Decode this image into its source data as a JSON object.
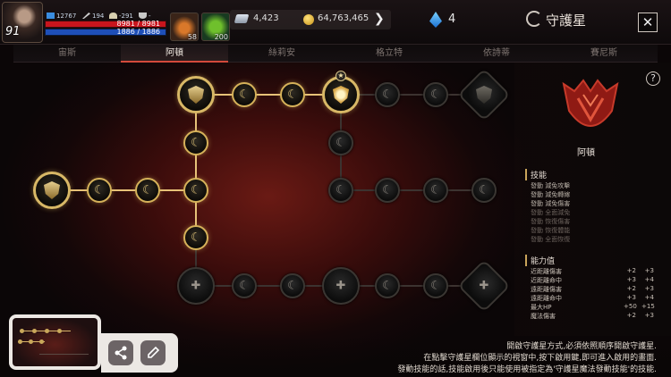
{
  "player": {
    "level": "91",
    "stat1": "12767",
    "stat2": "194",
    "stat3": "-291",
    "stat4": "-",
    "hp": "8981 / 8981",
    "mp": "1886 / 1886"
  },
  "slots": [
    {
      "icon": "flask-icon",
      "count": "58"
    },
    {
      "icon": "leaf-icon",
      "count": "200"
    }
  ],
  "currency": {
    "silver": "4,423",
    "gold": "64,763,465",
    "gems": "4"
  },
  "header": {
    "title": "守護星",
    "close": "✕"
  },
  "tabs": [
    {
      "label": "宙斯",
      "active": false
    },
    {
      "label": "阿頓",
      "active": true
    },
    {
      "label": "絲莉安",
      "active": false
    },
    {
      "label": "格立特",
      "active": false
    },
    {
      "label": "依詩蒂",
      "active": false
    },
    {
      "label": "賽尼斯",
      "active": false
    }
  ],
  "panel": {
    "help": "?",
    "name": "阿頓",
    "skills_title": "技能",
    "skills": [
      {
        "text": "發動 減免攻擊",
        "enabled": true
      },
      {
        "text": "發動 減免轉嫁",
        "enabled": true
      },
      {
        "text": "發動 減免傷害",
        "enabled": true
      },
      {
        "text": "發動 全面減免",
        "enabled": false
      },
      {
        "text": "發動 恢復傷害",
        "enabled": false
      },
      {
        "text": "發動 恢復體能",
        "enabled": false
      },
      {
        "text": "發動 全面恢復",
        "enabled": false
      }
    ],
    "ability_title": "能力值",
    "abilities": [
      {
        "label": "近距離傷害",
        "v1": "+2",
        "v2": "+3"
      },
      {
        "label": "近距離命中",
        "v1": "+3",
        "v2": "+4"
      },
      {
        "label": "遠距離傷害",
        "v1": "+2",
        "v2": "+3"
      },
      {
        "label": "遠距離命中",
        "v1": "+3",
        "v2": "+4"
      },
      {
        "label": "最大HP",
        "v1": "+50",
        "v2": "+15"
      },
      {
        "label": "魔法傷害",
        "v1": "+2",
        "v2": "+3"
      }
    ]
  },
  "description": [
    "開啟守護星方式,必須依照順序開啟守護星.",
    "在點擊守護星欄位顯示的視窗中,按下啟用鍵,即可進入啟用的畫面.",
    "發動技能的話,技能啟用後只能使用被指定為'守護星魔法發動技能'的技能."
  ],
  "toolbar": {
    "share_icon": "share-icon",
    "edit_icon": "pencil-icon"
  },
  "colors": {
    "accent": "#d34a3b",
    "gold": "#d6b25a",
    "hp": "#c8151d",
    "mp": "#1e4fb8"
  }
}
